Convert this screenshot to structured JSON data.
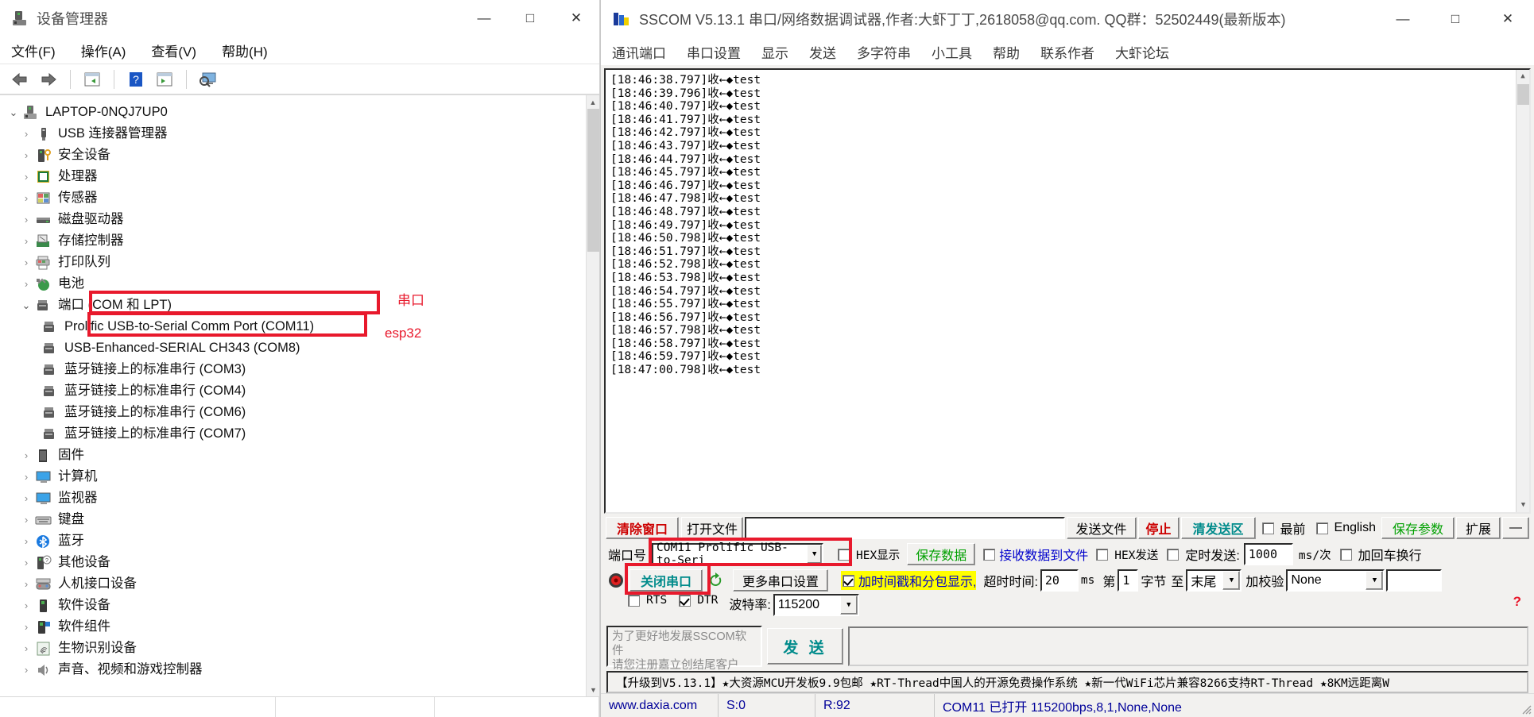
{
  "device_manager": {
    "title": "设备管理器",
    "window_buttons": {
      "minimize": "—",
      "maximize": "□",
      "close": "✕"
    },
    "menus": [
      "文件(F)",
      "操作(A)",
      "查看(V)",
      "帮助(H)"
    ],
    "toolbar_icons": [
      "back-arrow-icon",
      "forward-arrow-icon",
      "properties-icon",
      "help-icon",
      "scan-icon",
      "display-icon"
    ],
    "tree": {
      "root": {
        "label": "LAPTOP-0NQJ7UP0",
        "icon": "computer-icon",
        "expanded": true
      },
      "nodes": [
        {
          "label": "USB 连接器管理器",
          "icon": "usb-icon",
          "expandable": true
        },
        {
          "label": "安全设备",
          "icon": "security-device-icon",
          "expandable": true
        },
        {
          "label": "处理器",
          "icon": "processor-icon",
          "expandable": true
        },
        {
          "label": "传感器",
          "icon": "sensor-icon",
          "expandable": true
        },
        {
          "label": "磁盘驱动器",
          "icon": "disk-drive-icon",
          "expandable": true
        },
        {
          "label": "存储控制器",
          "icon": "storage-controller-icon",
          "expandable": true
        },
        {
          "label": "打印队列",
          "icon": "printer-icon",
          "expandable": true
        },
        {
          "label": "电池",
          "icon": "battery-icon",
          "expandable": true
        },
        {
          "label": "端口 (COM 和 LPT)",
          "icon": "port-icon",
          "expandable": true,
          "expanded": true
        },
        {
          "label": "固件",
          "icon": "firmware-icon",
          "expandable": true
        },
        {
          "label": "计算机",
          "icon": "computer-monitor-icon",
          "expandable": true
        },
        {
          "label": "监视器",
          "icon": "monitor-icon",
          "expandable": true
        },
        {
          "label": "键盘",
          "icon": "keyboard-icon",
          "expandable": true
        },
        {
          "label": "蓝牙",
          "icon": "bluetooth-icon",
          "expandable": true
        },
        {
          "label": "其他设备",
          "icon": "other-device-icon",
          "expandable": true
        },
        {
          "label": "人机接口设备",
          "icon": "hid-icon",
          "expandable": true
        },
        {
          "label": "软件设备",
          "icon": "software-device-icon",
          "expandable": true
        },
        {
          "label": "软件组件",
          "icon": "software-component-icon",
          "expandable": true
        },
        {
          "label": "生物识别设备",
          "icon": "biometric-icon",
          "expandable": true
        },
        {
          "label": "声音、视频和游戏控制器",
          "icon": "sound-icon",
          "expandable": true
        }
      ],
      "ports": [
        {
          "label": "Prolific USB-to-Serial Comm Port (COM11)",
          "icon": "port-icon",
          "highlighted": true
        },
        {
          "label": "USB-Enhanced-SERIAL CH343 (COM8)",
          "icon": "port-icon",
          "highlighted": true
        },
        {
          "label": "蓝牙链接上的标准串行 (COM3)",
          "icon": "port-icon"
        },
        {
          "label": "蓝牙链接上的标准串行 (COM4)",
          "icon": "port-icon"
        },
        {
          "label": "蓝牙链接上的标准串行 (COM6)",
          "icon": "port-icon"
        },
        {
          "label": "蓝牙链接上的标准串行 (COM7)",
          "icon": "port-icon"
        }
      ]
    },
    "annotations": [
      {
        "text": "串口",
        "color": "#e8192c"
      },
      {
        "text": "esp32",
        "color": "#e8192c"
      }
    ]
  },
  "sscom": {
    "title": "SSCOM V5.13.1 串口/网络数据调试器,作者:大虾丁丁,2618058@qq.com. QQ群：52502449(最新版本)",
    "window_buttons": {
      "minimize": "—",
      "maximize": "□",
      "close": "✕"
    },
    "menus": [
      "通讯端口",
      "串口设置",
      "显示",
      "发送",
      "多字符串",
      "小工具",
      "帮助",
      "联系作者",
      "大虾论坛"
    ],
    "log_lines": [
      "[18:46:38.797]收←◆test",
      "[18:46:39.796]收←◆test",
      "[18:46:40.797]收←◆test",
      "[18:46:41.797]收←◆test",
      "[18:46:42.797]收←◆test",
      "[18:46:43.797]收←◆test",
      "[18:46:44.797]收←◆test",
      "[18:46:45.797]收←◆test",
      "[18:46:46.797]收←◆test",
      "[18:46:47.798]收←◆test",
      "[18:46:48.797]收←◆test",
      "[18:46:49.797]收←◆test",
      "[18:46:50.798]收←◆test",
      "[18:46:51.797]收←◆test",
      "[18:46:52.798]收←◆test",
      "[18:46:53.798]收←◆test",
      "[18:46:54.797]收←◆test",
      "[18:46:55.797]收←◆test",
      "[18:46:56.797]收←◆test",
      "[18:46:57.798]收←◆test",
      "[18:46:58.797]收←◆test",
      "[18:46:59.797]收←◆test",
      "[18:47:00.798]收←◆test"
    ],
    "controls": {
      "clear_window": "清除窗口",
      "open_file": "打开文件",
      "file_path_value": "",
      "send_file": "发送文件",
      "stop": "停止",
      "clear_send_area": "清发送区",
      "topmost_label": "最前",
      "topmost_checked": false,
      "english_label": "English",
      "english_checked": false,
      "save_params": "保存参数",
      "extend": "扩展",
      "collapse": "—",
      "port_label": "端口号",
      "port_value": "COM11 Prolific USB-to-Seri",
      "hex_display_label": "HEX显示",
      "hex_display_checked": false,
      "save_data": "保存数据",
      "recv_to_file_label": "接收数据到文件",
      "recv_to_file_checked": false,
      "hex_send_label": "HEX发送",
      "hex_send_checked": false,
      "timed_send_label": "定时发送:",
      "timed_send_checked": false,
      "timed_send_value": "1000",
      "ms_per_time": "ms/次",
      "add_crlf_label": "加回车换行",
      "add_crlf_checked": false,
      "close_port": "关闭串口",
      "refresh_icon": "refresh-icon",
      "more_port_settings": "更多串口设置",
      "timestamp_label": "加时间戳和分包显示,",
      "timestamp_checked": true,
      "timeout_label": "超时时间:",
      "timeout_value": "20",
      "ms": "ms",
      "byte_prefix": "第",
      "byte_index": "1",
      "byte_unit": "字节",
      "to_label": "至",
      "to_value": "末尾",
      "checksum_label": "加校验",
      "checksum_value": "None",
      "rts_label": "RTS",
      "rts_checked": false,
      "dtr_label": "DTR",
      "dtr_checked": true,
      "baud_label": "波特率:",
      "baud_value": "115200",
      "promo_line1": "为了更好地发展SSCOM软件",
      "promo_line2": "请您注册嘉立创结尾客户",
      "send_button": "发 送",
      "help_badge": "?"
    },
    "banner": "【升级到V5.13.1】★大资源MCU开发板9.9包邮 ★RT-Thread中国人的开源免费操作系统 ★新一代WiFi芯片兼容8266支持RT-Thread ★8KM远距离W",
    "status": {
      "site": "www.daxia.com",
      "sent": "S:0",
      "received": "R:92",
      "port_state": "COM11 已打开  115200bps,8,1,None,None"
    }
  }
}
